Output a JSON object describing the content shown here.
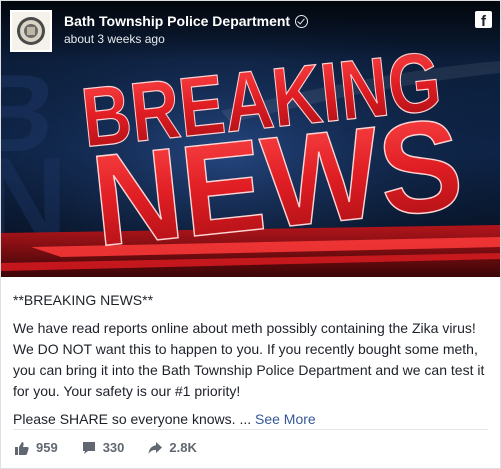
{
  "post": {
    "page_name": "Bath Township Police Department",
    "timestamp": "about 3 weeks ago",
    "image_text": {
      "line1": "BREAKING",
      "line2": "NEWS"
    },
    "icons": {
      "verified": "verified-badge-icon",
      "brand": "facebook-icon",
      "avatar": "police-badge-avatar"
    },
    "body": {
      "heading": "**BREAKING NEWS**",
      "paragraph": "We have read reports online about meth possibly containing the Zika virus! We DO NOT want this to happen to you. If you recently bought some meth, you can bring it into the Bath Township Police Department and we can test it for you. Your safety is our #1 priority!",
      "share_line": "Please SHARE so everyone knows. ...",
      "see_more": "See More"
    },
    "stats": {
      "likes": "959",
      "comments": "330",
      "shares": "2.8K"
    },
    "colors": {
      "headline_red": "#e01e24",
      "link_blue": "#365899",
      "text": "#1d2129",
      "muted": "#616770"
    }
  }
}
